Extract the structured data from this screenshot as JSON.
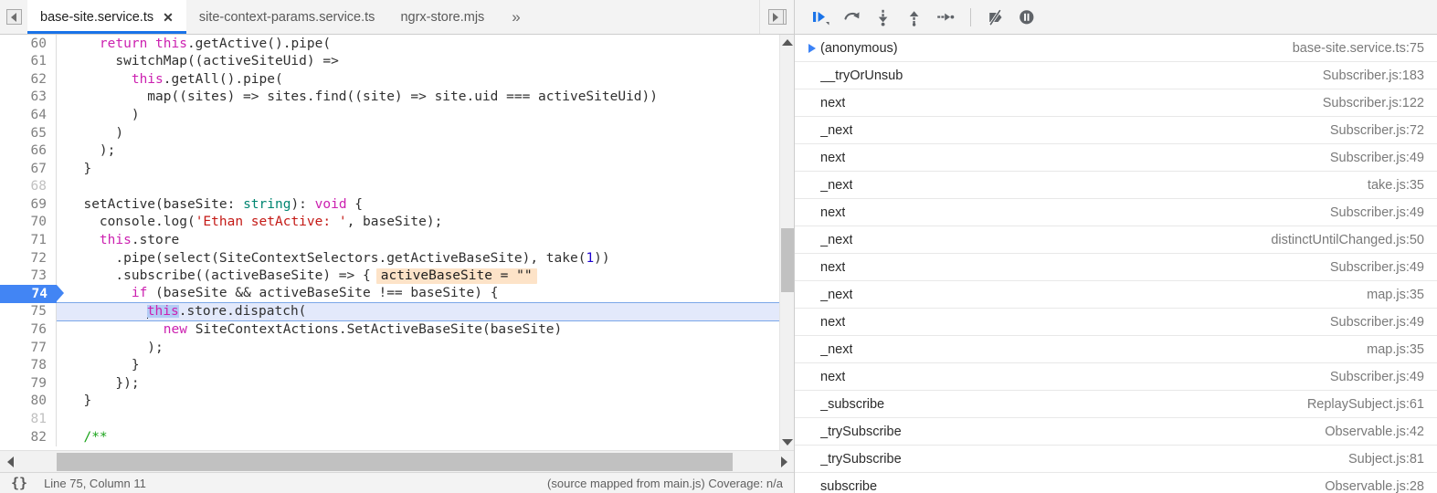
{
  "tabbar": {
    "nav_prev_icon": "tab-scroll-left-icon",
    "nav_next_icon": "tab-scroll-right-icon",
    "overflow_label": "»",
    "close_glyph": "✕",
    "tabs": [
      {
        "label": "base-site.service.ts",
        "active": true,
        "closable": true
      },
      {
        "label": "site-context-params.service.ts",
        "active": false,
        "closable": false
      },
      {
        "label": "ngrx-store.mjs",
        "active": false,
        "closable": false
      }
    ]
  },
  "editor": {
    "lines": [
      {
        "num": "60",
        "dim": false,
        "state": "normal",
        "tokens": [
          {
            "t": "    ",
            "c": ""
          },
          {
            "t": "return ",
            "c": "t-kw"
          },
          {
            "t": "this",
            "c": "t-this"
          },
          {
            "t": ".getActive().pipe(",
            "c": ""
          }
        ]
      },
      {
        "num": "61",
        "dim": false,
        "state": "normal",
        "tokens": [
          {
            "t": "      switchMap((activeSiteUid) =>",
            "c": ""
          }
        ]
      },
      {
        "num": "62",
        "dim": false,
        "state": "normal",
        "tokens": [
          {
            "t": "        ",
            "c": ""
          },
          {
            "t": "this",
            "c": "t-this"
          },
          {
            "t": ".getAll().pipe(",
            "c": ""
          }
        ]
      },
      {
        "num": "63",
        "dim": false,
        "state": "normal",
        "tokens": [
          {
            "t": "          map((sites) => sites.find((site) => site.uid === activeSiteUid))",
            "c": ""
          }
        ]
      },
      {
        "num": "64",
        "dim": false,
        "state": "normal",
        "tokens": [
          {
            "t": "        )",
            "c": ""
          }
        ]
      },
      {
        "num": "65",
        "dim": false,
        "state": "normal",
        "tokens": [
          {
            "t": "      )",
            "c": ""
          }
        ]
      },
      {
        "num": "66",
        "dim": false,
        "state": "normal",
        "tokens": [
          {
            "t": "    );",
            "c": ""
          }
        ]
      },
      {
        "num": "67",
        "dim": false,
        "state": "normal",
        "tokens": [
          {
            "t": "  }",
            "c": ""
          }
        ]
      },
      {
        "num": "68",
        "dim": true,
        "state": "normal",
        "tokens": []
      },
      {
        "num": "69",
        "dim": false,
        "state": "normal",
        "tokens": [
          {
            "t": "  setActive(baseSite: ",
            "c": ""
          },
          {
            "t": "string",
            "c": "t-type"
          },
          {
            "t": "): ",
            "c": ""
          },
          {
            "t": "void",
            "c": "t-kw"
          },
          {
            "t": " {",
            "c": ""
          }
        ]
      },
      {
        "num": "70",
        "dim": false,
        "state": "normal",
        "tokens": [
          {
            "t": "    console.log(",
            "c": ""
          },
          {
            "t": "'Ethan setActive: '",
            "c": "t-str"
          },
          {
            "t": ", baseSite);",
            "c": ""
          }
        ]
      },
      {
        "num": "71",
        "dim": false,
        "state": "normal",
        "tokens": [
          {
            "t": "    ",
            "c": ""
          },
          {
            "t": "this",
            "c": "t-this"
          },
          {
            "t": ".store",
            "c": ""
          }
        ]
      },
      {
        "num": "72",
        "dim": false,
        "state": "normal",
        "tokens": [
          {
            "t": "      .pipe(select(SiteContextSelectors.getActiveBaseSite), take(",
            "c": ""
          },
          {
            "t": "1",
            "c": "t-num"
          },
          {
            "t": "))",
            "c": ""
          }
        ]
      },
      {
        "num": "73",
        "dim": false,
        "state": "normal",
        "tokens": [
          {
            "t": "      .subscribe((activeBaseSite) => {",
            "c": ""
          }
        ],
        "inline_value": "activeBaseSite = \"\""
      },
      {
        "num": "74",
        "dim": false,
        "state": "exec",
        "tokens": [
          {
            "t": "        ",
            "c": ""
          },
          {
            "t": "if",
            "c": "t-kw"
          },
          {
            "t": " (baseSite && activeBaseSite !== baseSite) {",
            "c": ""
          }
        ]
      },
      {
        "num": "75",
        "dim": false,
        "state": "cursor",
        "tokens": [
          {
            "t": "          ",
            "c": ""
          },
          {
            "t": "__CARET__",
            "c": "caret"
          },
          {
            "t": "this",
            "c": "t-this t-sel"
          },
          {
            "t": ".store.dispatch(",
            "c": ""
          }
        ]
      },
      {
        "num": "76",
        "dim": false,
        "state": "normal",
        "tokens": [
          {
            "t": "            ",
            "c": ""
          },
          {
            "t": "new",
            "c": "t-kw"
          },
          {
            "t": " SiteContextActions.SetActiveBaseSite(baseSite)",
            "c": ""
          }
        ]
      },
      {
        "num": "77",
        "dim": false,
        "state": "normal",
        "tokens": [
          {
            "t": "          );",
            "c": ""
          }
        ]
      },
      {
        "num": "78",
        "dim": false,
        "state": "normal",
        "tokens": [
          {
            "t": "        }",
            "c": ""
          }
        ]
      },
      {
        "num": "79",
        "dim": false,
        "state": "normal",
        "tokens": [
          {
            "t": "      });",
            "c": ""
          }
        ]
      },
      {
        "num": "80",
        "dim": false,
        "state": "normal",
        "tokens": [
          {
            "t": "  }",
            "c": ""
          }
        ]
      },
      {
        "num": "81",
        "dim": true,
        "state": "normal",
        "tokens": []
      },
      {
        "num": "82",
        "dim": false,
        "state": "normal",
        "tokens": [
          {
            "t": "  /**",
            "c": "t-com"
          }
        ]
      }
    ]
  },
  "statusbar": {
    "pretty_print_glyph": "{}",
    "cursor_position": "Line 75, Column 11",
    "source_info": "(source mapped from main.js) Coverage: n/a"
  },
  "debug_toolbar": {
    "buttons": [
      {
        "name": "resume-script-execution-button",
        "icon": "resume-icon",
        "active": true
      },
      {
        "name": "step-over-next-function-call-button",
        "icon": "step-over-icon",
        "active": false
      },
      {
        "name": "step-into-next-function-call-button",
        "icon": "step-into-icon",
        "active": false
      },
      {
        "name": "step-out-of-current-function-button",
        "icon": "step-out-icon",
        "active": false
      },
      {
        "name": "step-button",
        "icon": "step-icon",
        "active": false
      },
      {
        "name": "deactivate-breakpoints-button",
        "icon": "deactivate-breakpoints-icon",
        "active": false
      },
      {
        "name": "pause-on-exceptions-button",
        "icon": "pause-on-exceptions-icon",
        "active": false
      }
    ],
    "accent_color": "#1a73e8",
    "icon_color": "#5f6368"
  },
  "call_stack": {
    "frames": [
      {
        "name": "(anonymous)",
        "location": "base-site.service.ts:75",
        "selected": true
      },
      {
        "name": "__tryOrUnsub",
        "location": "Subscriber.js:183",
        "selected": false
      },
      {
        "name": "next",
        "location": "Subscriber.js:122",
        "selected": false
      },
      {
        "name": "_next",
        "location": "Subscriber.js:72",
        "selected": false
      },
      {
        "name": "next",
        "location": "Subscriber.js:49",
        "selected": false
      },
      {
        "name": "_next",
        "location": "take.js:35",
        "selected": false
      },
      {
        "name": "next",
        "location": "Subscriber.js:49",
        "selected": false
      },
      {
        "name": "_next",
        "location": "distinctUntilChanged.js:50",
        "selected": false
      },
      {
        "name": "next",
        "location": "Subscriber.js:49",
        "selected": false
      },
      {
        "name": "_next",
        "location": "map.js:35",
        "selected": false
      },
      {
        "name": "next",
        "location": "Subscriber.js:49",
        "selected": false
      },
      {
        "name": "_next",
        "location": "map.js:35",
        "selected": false
      },
      {
        "name": "next",
        "location": "Subscriber.js:49",
        "selected": false
      },
      {
        "name": "_subscribe",
        "location": "ReplaySubject.js:61",
        "selected": false
      },
      {
        "name": "_trySubscribe",
        "location": "Observable.js:42",
        "selected": false
      },
      {
        "name": "_trySubscribe",
        "location": "Subject.js:81",
        "selected": false
      },
      {
        "name": "subscribe",
        "location": "Observable.js:28",
        "selected": false
      }
    ]
  }
}
